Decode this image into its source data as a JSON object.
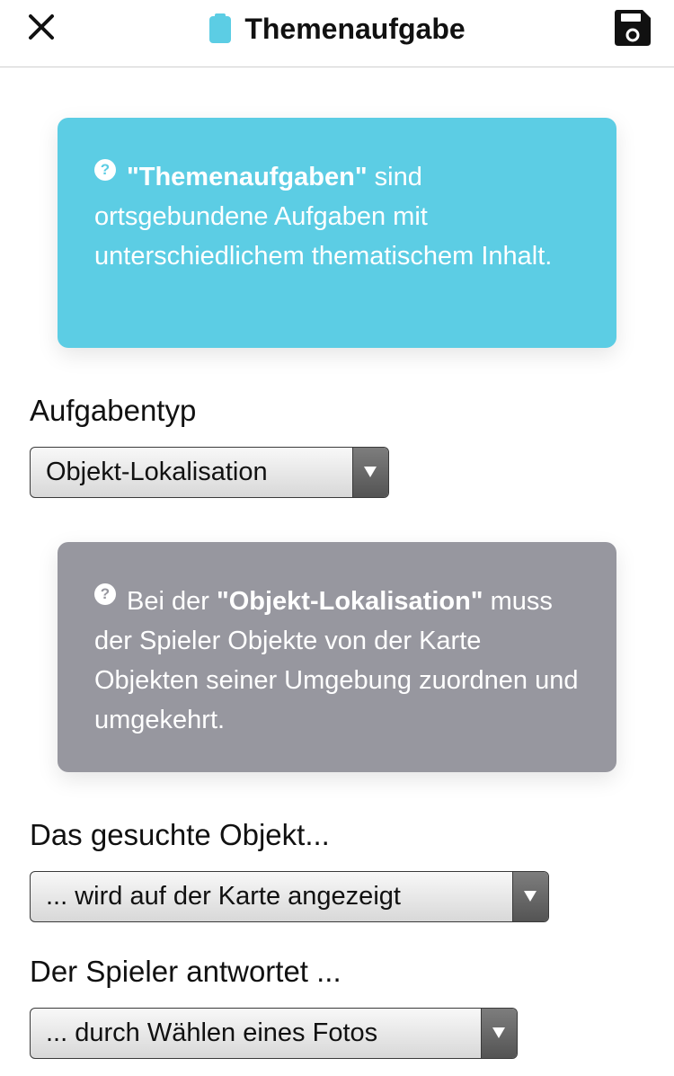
{
  "header": {
    "title": "Themenaufgabe",
    "close_icon": "close-icon",
    "task_icon": "clipboard-icon",
    "save_icon": "floppy-disk-icon",
    "accent_color": "#5ccde4"
  },
  "info_theme": {
    "icon": "question-icon",
    "bold": "\"Themenaufgaben\"",
    "text": " sind ortsgebundene Aufgaben mit unterschiedlichem thematischem Inhalt.",
    "color": "#5ccde4"
  },
  "task_type": {
    "label": "Aufgabentyp",
    "value": "Objekt-Lokalisation"
  },
  "info_type": {
    "icon": "question-icon",
    "prefix": "Bei der ",
    "bold": "\"Objekt-Lokalisation\"",
    "text": " muss der Spieler Objekte von der Karte Objekten seiner Umgebung zuordnen und umgekehrt.",
    "color": "#97979f"
  },
  "object_select": {
    "label": "Das gesuchte Objekt...",
    "value": "... wird auf der Karte angezeigt"
  },
  "answer_select": {
    "label": "Der Spieler antwortet ...",
    "value": "... durch Wählen eines Fotos"
  }
}
